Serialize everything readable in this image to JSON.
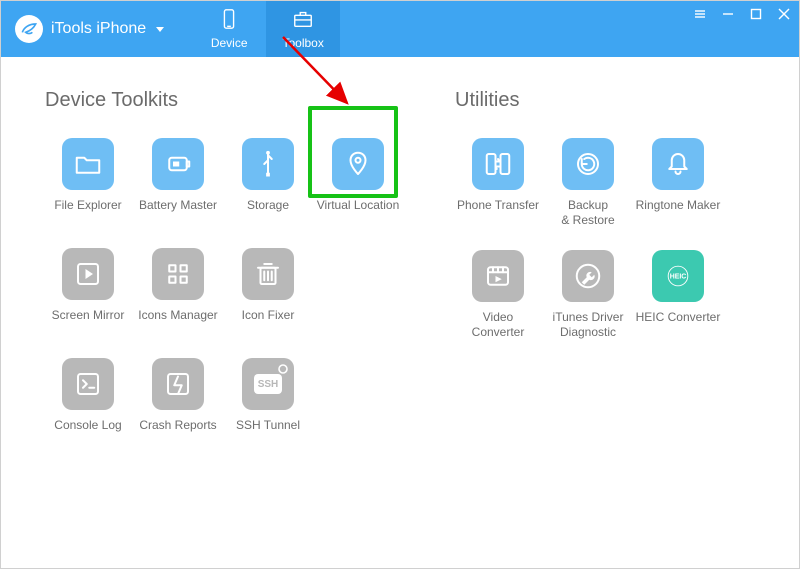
{
  "brand": {
    "title": "iTools iPhone"
  },
  "nav": {
    "device": "Device",
    "toolbox": "Toolbox"
  },
  "sections": {
    "toolkits_title": "Device Toolkits",
    "utilities_title": "Utilities"
  },
  "tools": {
    "file_explorer": "File Explorer",
    "battery_master": "Battery Master",
    "storage": "Storage",
    "virtual_location": "Virtual Location",
    "screen_mirror": "Screen Mirror",
    "icons_manager": "Icons Manager",
    "icon_fixer": "Icon Fixer",
    "console_log": "Console Log",
    "crash_reports": "Crash Reports",
    "ssh_tunnel": "SSH Tunnel"
  },
  "utils": {
    "phone_transfer": "Phone Transfer",
    "backup_restore": "Backup\n& Restore",
    "ringtone_maker": "Ringtone Maker",
    "video_converter": "Video\nConverter",
    "itunes_diag": "iTunes Driver\nDiagnostic",
    "heic_converter": "HEIC Converter"
  },
  "misc": {
    "ssh_label": "SSH",
    "heic_label": "HEIC"
  }
}
